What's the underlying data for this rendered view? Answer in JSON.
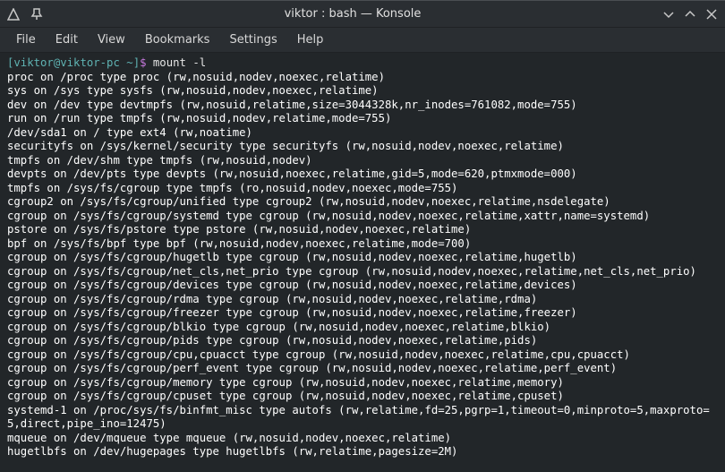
{
  "window": {
    "title": "viktor : bash — Konsole"
  },
  "menubar": {
    "file": "File",
    "edit": "Edit",
    "view": "View",
    "bookmarks": "Bookmarks",
    "settings": "Settings",
    "help": "Help"
  },
  "prompt": {
    "open_bracket": "[",
    "user_host": "viktor@viktor-pc",
    "cwd": " ~",
    "close_bracket": "]",
    "dollar": "$ "
  },
  "command": "mount -l",
  "output_lines": [
    "proc on /proc type proc (rw,nosuid,nodev,noexec,relatime)",
    "sys on /sys type sysfs (rw,nosuid,nodev,noexec,relatime)",
    "dev on /dev type devtmpfs (rw,nosuid,relatime,size=3044328k,nr_inodes=761082,mode=755)",
    "run on /run type tmpfs (rw,nosuid,nodev,relatime,mode=755)",
    "/dev/sda1 on / type ext4 (rw,noatime)",
    "securityfs on /sys/kernel/security type securityfs (rw,nosuid,nodev,noexec,relatime)",
    "tmpfs on /dev/shm type tmpfs (rw,nosuid,nodev)",
    "devpts on /dev/pts type devpts (rw,nosuid,noexec,relatime,gid=5,mode=620,ptmxmode=000)",
    "tmpfs on /sys/fs/cgroup type tmpfs (ro,nosuid,nodev,noexec,mode=755)",
    "cgroup2 on /sys/fs/cgroup/unified type cgroup2 (rw,nosuid,nodev,noexec,relatime,nsdelegate)",
    "cgroup on /sys/fs/cgroup/systemd type cgroup (rw,nosuid,nodev,noexec,relatime,xattr,name=systemd)",
    "pstore on /sys/fs/pstore type pstore (rw,nosuid,nodev,noexec,relatime)",
    "bpf on /sys/fs/bpf type bpf (rw,nosuid,nodev,noexec,relatime,mode=700)",
    "cgroup on /sys/fs/cgroup/hugetlb type cgroup (rw,nosuid,nodev,noexec,relatime,hugetlb)",
    "cgroup on /sys/fs/cgroup/net_cls,net_prio type cgroup (rw,nosuid,nodev,noexec,relatime,net_cls,net_prio)",
    "cgroup on /sys/fs/cgroup/devices type cgroup (rw,nosuid,nodev,noexec,relatime,devices)",
    "cgroup on /sys/fs/cgroup/rdma type cgroup (rw,nosuid,nodev,noexec,relatime,rdma)",
    "cgroup on /sys/fs/cgroup/freezer type cgroup (rw,nosuid,nodev,noexec,relatime,freezer)",
    "cgroup on /sys/fs/cgroup/blkio type cgroup (rw,nosuid,nodev,noexec,relatime,blkio)",
    "cgroup on /sys/fs/cgroup/pids type cgroup (rw,nosuid,nodev,noexec,relatime,pids)",
    "cgroup on /sys/fs/cgroup/cpu,cpuacct type cgroup (rw,nosuid,nodev,noexec,relatime,cpu,cpuacct)",
    "cgroup on /sys/fs/cgroup/perf_event type cgroup (rw,nosuid,nodev,noexec,relatime,perf_event)",
    "cgroup on /sys/fs/cgroup/memory type cgroup (rw,nosuid,nodev,noexec,relatime,memory)",
    "cgroup on /sys/fs/cgroup/cpuset type cgroup (rw,nosuid,nodev,noexec,relatime,cpuset)",
    "systemd-1 on /proc/sys/fs/binfmt_misc type autofs (rw,relatime,fd=25,pgrp=1,timeout=0,minproto=5,maxproto=5,direct,pipe_ino=12475)",
    "mqueue on /dev/mqueue type mqueue (rw,nosuid,nodev,noexec,relatime)",
    "hugetlbfs on /dev/hugepages type hugetlbfs (rw,relatime,pagesize=2M)"
  ]
}
